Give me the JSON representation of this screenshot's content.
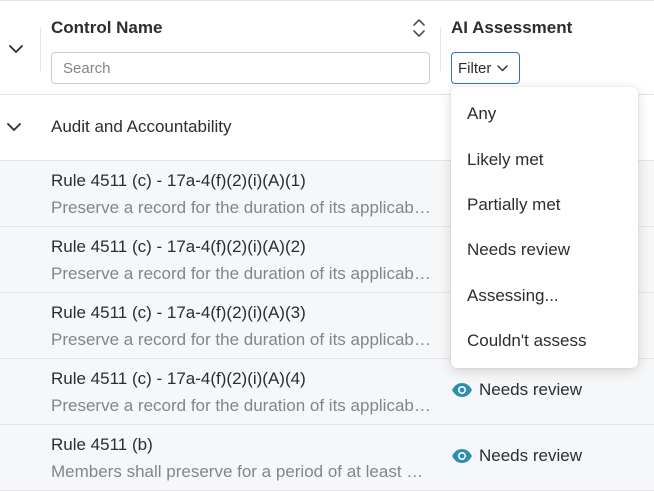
{
  "header": {
    "control_name_title": "Control Name",
    "ai_assessment_title": "AI Assessment",
    "search_placeholder": "Search",
    "filter_label": "Filter"
  },
  "group": {
    "label": "Audit and Accountability"
  },
  "rows": [
    {
      "title": "Rule 4511 (c) - 17a-4(f)(2)(i)(A)(1)",
      "description": "Preserve a record for the duration of its applicable retention period",
      "status": ""
    },
    {
      "title": "Rule 4511 (c) - 17a-4(f)(2)(i)(A)(2)",
      "description": "Preserve a record for the duration of its applicable retention period",
      "status": ""
    },
    {
      "title": "Rule 4511 (c) - 17a-4(f)(2)(i)(A)(3)",
      "description": "Preserve a record for the duration of its applicable retention period",
      "status": ""
    },
    {
      "title": "Rule 4511 (c) - 17a-4(f)(2)(i)(A)(4)",
      "description": "Preserve a record for the duration of its applicable retention period",
      "status": "Needs review"
    },
    {
      "title": "Rule 4511 (b)",
      "description": "Members shall preserve for a period of at least six years",
      "status": "Needs review"
    }
  ],
  "filter_menu": {
    "options": [
      "Any",
      "Likely met",
      "Partially met",
      "Needs review",
      "Assessing...",
      "Couldn't assess"
    ]
  },
  "colors": {
    "accent": "#2f6fd1",
    "eye_icon": "#2c8fb0",
    "row_bg": "#f6f7f8"
  }
}
